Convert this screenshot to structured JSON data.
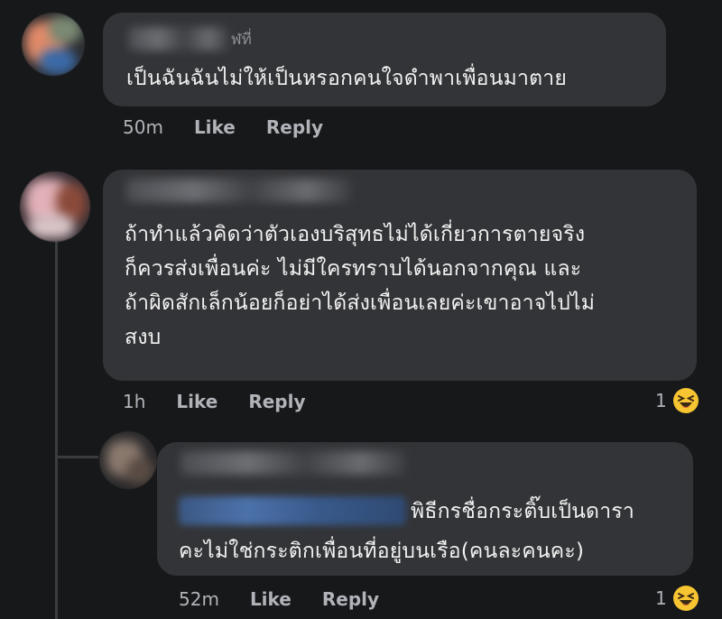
{
  "comments": [
    {
      "author_tail": "ฬที่",
      "text": "เป็นฉันฉันไม่ให้เป็นหรอกคนใจดำพาเพื่อนมาตาย",
      "time": "50m",
      "like_label": "Like",
      "reply_label": "Reply"
    },
    {
      "text": "ถ้าทำแล้วคิดว่าตัวเองบริสุทธไม่ได้เกี่ยวการตายจริง\nก็ควรส่งเพื่อนค่ะ ไม่มีใครทราบได้นอกจากคุณ และ\nถ้าผิดสักเล็กน้อยก็อย่าได้ส่งเพื่อนเลยค่ะเขาอาจไปไม่\nสงบ",
      "time": "1h",
      "like_label": "Like",
      "reply_label": "Reply",
      "reaction_count": "1",
      "reaction_icon": "laughing-emoji-icon"
    },
    {
      "text_line1": "พิธีกรชื่อกระติ๊บเป็นดารา",
      "text_line2": "คะไม่ใช่กระติกเพื่อนที่อยู่บนเรือ(คนละคนคะ)",
      "time": "52m",
      "like_label": "Like",
      "reply_label": "Reply",
      "reaction_count": "1",
      "reaction_icon": "laughing-emoji-icon"
    }
  ],
  "colors": {
    "background": "#17181a",
    "bubble": "#333437",
    "text": "#f2f2f2",
    "meta": "#b0b3b8",
    "emoji": "#f7c531"
  }
}
